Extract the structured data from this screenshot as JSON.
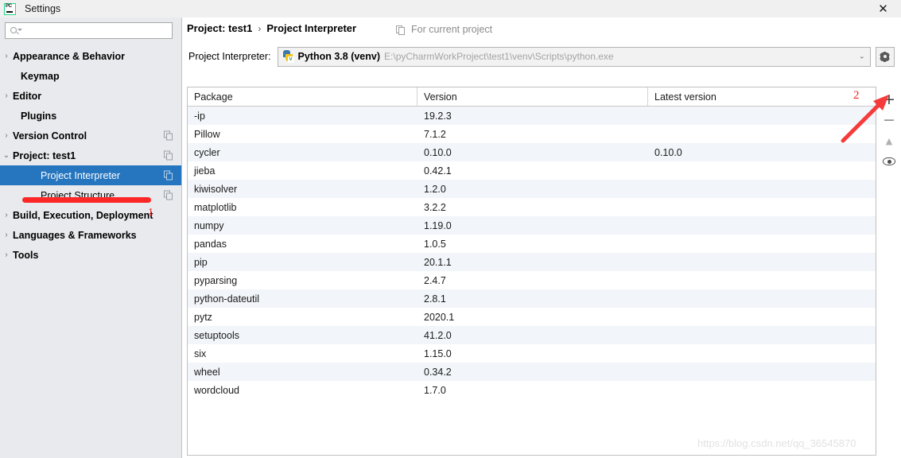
{
  "window": {
    "title": "Settings",
    "logo_text": "PC",
    "close_label": "✕"
  },
  "sidebar": {
    "search": {
      "value": "",
      "placeholder": ""
    },
    "items": [
      {
        "label": "Appearance & Behavior",
        "arrow": "›",
        "indent": 0,
        "bold": true,
        "selected": false,
        "copy": false
      },
      {
        "label": "Keymap",
        "arrow": "",
        "indent": 1,
        "bold": true,
        "selected": false,
        "copy": false
      },
      {
        "label": "Editor",
        "arrow": "›",
        "indent": 0,
        "bold": true,
        "selected": false,
        "copy": false
      },
      {
        "label": "Plugins",
        "arrow": "",
        "indent": 1,
        "bold": true,
        "selected": false,
        "copy": false
      },
      {
        "label": "Version Control",
        "arrow": "›",
        "indent": 0,
        "bold": true,
        "selected": false,
        "copy": true
      },
      {
        "label": "Project: test1",
        "arrow": "⌄",
        "indent": 0,
        "bold": true,
        "selected": false,
        "copy": true
      },
      {
        "label": "Project Interpreter",
        "arrow": "",
        "indent": 2,
        "bold": false,
        "selected": true,
        "copy": true
      },
      {
        "label": "Project Structure",
        "arrow": "",
        "indent": 2,
        "bold": false,
        "selected": false,
        "copy": true
      },
      {
        "label": "Build, Execution, Deployment",
        "arrow": "›",
        "indent": 0,
        "bold": true,
        "selected": false,
        "copy": false
      },
      {
        "label": "Languages & Frameworks",
        "arrow": "›",
        "indent": 0,
        "bold": true,
        "selected": false,
        "copy": false
      },
      {
        "label": "Tools",
        "arrow": "›",
        "indent": 0,
        "bold": true,
        "selected": false,
        "copy": false
      }
    ]
  },
  "annotations": {
    "marker_1": "1",
    "marker_2": "2",
    "color": "#f02222"
  },
  "main": {
    "breadcrumb": {
      "root": "Project: test1",
      "separator": "›",
      "current": "Project Interpreter"
    },
    "for_current_project": "For current project",
    "interpreter": {
      "label": "Project Interpreter:",
      "name": "Python 3.8 (venv)",
      "path": "E:\\pyCharmWorkProject\\test1\\venv\\Scripts\\python.exe",
      "venv_badge": "v",
      "dropdown_arrow": "⌄"
    },
    "table": {
      "headers": [
        "Package",
        "Version",
        "Latest version"
      ],
      "rows": [
        {
          "package": "-ip",
          "version": "19.2.3",
          "latest": ""
        },
        {
          "package": "Pillow",
          "version": "7.1.2",
          "latest": ""
        },
        {
          "package": "cycler",
          "version": "0.10.0",
          "latest": "0.10.0"
        },
        {
          "package": "jieba",
          "version": "0.42.1",
          "latest": ""
        },
        {
          "package": "kiwisolver",
          "version": "1.2.0",
          "latest": ""
        },
        {
          "package": "matplotlib",
          "version": "3.2.2",
          "latest": ""
        },
        {
          "package": "numpy",
          "version": "1.19.0",
          "latest": ""
        },
        {
          "package": "pandas",
          "version": "1.0.5",
          "latest": ""
        },
        {
          "package": "pip",
          "version": "20.1.1",
          "latest": ""
        },
        {
          "package": "pyparsing",
          "version": "2.4.7",
          "latest": ""
        },
        {
          "package": "python-dateutil",
          "version": "2.8.1",
          "latest": ""
        },
        {
          "package": "pytz",
          "version": "2020.1",
          "latest": ""
        },
        {
          "package": "setuptools",
          "version": "41.2.0",
          "latest": ""
        },
        {
          "package": "six",
          "version": "1.15.0",
          "latest": ""
        },
        {
          "package": "wheel",
          "version": "0.34.2",
          "latest": ""
        },
        {
          "package": "wordcloud",
          "version": "1.7.0",
          "latest": ""
        }
      ]
    },
    "toolbar": {
      "add": "+",
      "remove": "−",
      "upgrade": "▲",
      "show_early_releases": "eye-icon"
    }
  },
  "watermark": "https://blog.csdn.net/qq_36545870"
}
